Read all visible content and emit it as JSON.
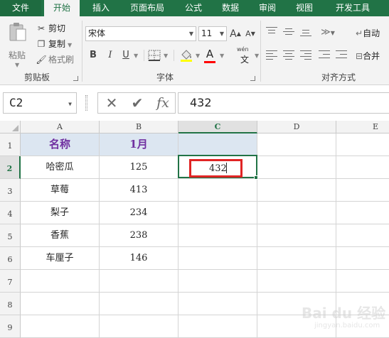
{
  "ribbon": {
    "tabs": [
      {
        "label": "文件"
      },
      {
        "label": "开始"
      },
      {
        "label": "插入"
      },
      {
        "label": "页面布局"
      },
      {
        "label": "公式"
      },
      {
        "label": "数据"
      },
      {
        "label": "审阅"
      },
      {
        "label": "视图"
      },
      {
        "label": "开发工具"
      }
    ],
    "active_tab": "开始",
    "colors": {
      "accent": "#217346",
      "ribbon_bg": "#f3f3f3"
    },
    "clipboard": {
      "group_label": "剪贴板",
      "paste_label": "粘贴",
      "paste_icon": "clipboard-paste-icon",
      "cut_label": "剪切",
      "cut_icon": "scissors-icon",
      "copy_label": "复制",
      "copy_icon": "copy-icon",
      "format_painter_label": "格式刷",
      "format_painter_icon": "paintbrush-icon"
    },
    "font": {
      "group_label": "字体",
      "font_name": "宋体",
      "font_size": "11",
      "grow_label": "A",
      "shrink_label": "A",
      "bold_label": "B",
      "italic_label": "I",
      "underline_label": "U",
      "font_color_label": "A",
      "font_color": "#ff0000",
      "phonetic_label": "wén",
      "phonetic_sub": "文"
    },
    "alignment": {
      "group_label": "对齐方式",
      "wrap_label": "自动",
      "merge_label": "合并"
    }
  },
  "formula_bar": {
    "name_box": "C2",
    "cancel_icon": "cancel-x-icon",
    "enter_icon": "check-icon",
    "fx_label": "fx",
    "value": "432"
  },
  "sheet": {
    "columns": [
      "A",
      "B",
      "C",
      "D",
      "E"
    ],
    "selected_column": "C",
    "rows": [
      "1",
      "2",
      "3",
      "4",
      "5",
      "6",
      "7",
      "8",
      "9"
    ],
    "selected_row": "2",
    "header": {
      "a": "名称",
      "b": "1月"
    },
    "data": [
      {
        "name": "哈密瓜",
        "value": "125"
      },
      {
        "name": "草莓",
        "value": "413"
      },
      {
        "name": "梨子",
        "value": "234"
      },
      {
        "name": "香蕉",
        "value": "238"
      },
      {
        "name": "车厘子",
        "value": "146"
      }
    ],
    "editing_cell": {
      "ref": "C2",
      "value": "432"
    },
    "header_fill": "#dce6f1",
    "header_text_color": "#7030a0",
    "highlight_color": "#e02424"
  },
  "watermark": {
    "text": "Bai du 经验",
    "sub": "jingyan.baidu.com"
  }
}
